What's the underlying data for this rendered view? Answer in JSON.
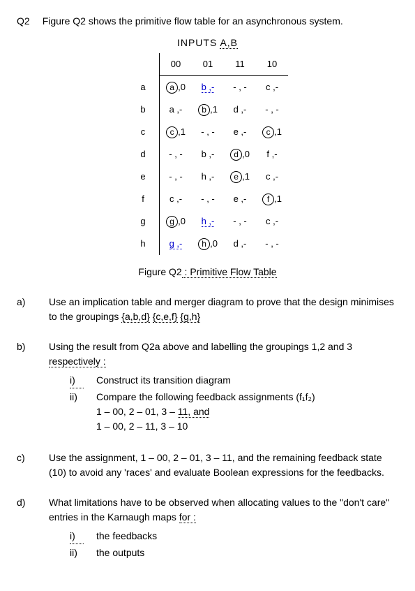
{
  "question_number": "Q2",
  "intro": "Figure Q2 shows the primitive flow table for an asynchronous system.",
  "inputs_label": "INPUTS ",
  "inputs_vars": "A,B",
  "col_headers": [
    "00",
    "01",
    "11",
    "10"
  ],
  "row_labels": [
    "a",
    "b",
    "c",
    "d",
    "e",
    "f",
    "g",
    "h"
  ],
  "cells": {
    "a": [
      {
        "c": "a",
        "o": ",0",
        "s": true
      },
      {
        "t": "b ,- ",
        "l": true
      },
      {
        "t": "- , -"
      },
      {
        "t": "c ,-"
      }
    ],
    "b": [
      {
        "t": "a ,-"
      },
      {
        "c": "b",
        "o": ",1",
        "s": true
      },
      {
        "t": "d ,-"
      },
      {
        "t": "- , -"
      }
    ],
    "c": [
      {
        "c": "c",
        "o": ",1",
        "s": true
      },
      {
        "t": "- , -"
      },
      {
        "t": "e ,-"
      },
      {
        "c": "c",
        "o": ",1",
        "s": true
      }
    ],
    "d": [
      {
        "t": "- , -"
      },
      {
        "t": "b ,-"
      },
      {
        "c": "d",
        "o": ",0",
        "s": true
      },
      {
        "t": "f ,-"
      }
    ],
    "e": [
      {
        "t": "- , -"
      },
      {
        "t": "h ,-"
      },
      {
        "c": "e",
        "o": ",1",
        "s": true
      },
      {
        "t": "c ,-"
      }
    ],
    "f": [
      {
        "t": "c ,-"
      },
      {
        "t": "- , -"
      },
      {
        "t": "e ,-"
      },
      {
        "c": "f",
        "o": ",1",
        "s": true
      }
    ],
    "g": [
      {
        "c": "g",
        "o": ",0",
        "s": true
      },
      {
        "t": "h ,-",
        "l": true
      },
      {
        "t": "- , -"
      },
      {
        "t": "c ,-"
      }
    ],
    "h": [
      {
        "t": "g ,-",
        "l": true
      },
      {
        "c": "h",
        "o": ",0",
        "s": true
      },
      {
        "t": "d ,-"
      },
      {
        "t": "- , -"
      }
    ]
  },
  "caption_pre": "Figure Q2",
  "caption_post": " : Primitive Flow Table",
  "parts": {
    "a": {
      "label": "a)",
      "text_pre": "Use an implication table and merger diagram to prove that the design minimises to the groupings ",
      "grp1": "{a,b,d}",
      "sep1": " ",
      "grp2": "{c,e,f}",
      "sep2": " ",
      "grp3": "{g,h}"
    },
    "b": {
      "label": "b)",
      "text_pre": "Using the result from Q2a above and labelling the groupings 1,2 and 3 ",
      "text_link": "respectively :",
      "i_label": "i)",
      "i_text": "Construct its transition diagram",
      "ii_label": "ii)",
      "ii_line1": "Compare the following feedback assignments (f₁f₂)",
      "ii_line2_pre": "1 – 00, 2 – 01, 3 – ",
      "ii_line2_link": "11,  and",
      "ii_line3": "1 – 00, 2 – 11, 3 – 10"
    },
    "c": {
      "label": "c)",
      "text": "Use the assignment, 1 – 00, 2 – 01, 3 – 11, and the remaining feedback state (10) to avoid any 'races' and evaluate Boolean expressions for the feedbacks."
    },
    "d": {
      "label": "d)",
      "text_pre": "What limitations have to be observed when allocating values to the \"don't care\" entries in the Karnaugh maps ",
      "text_link": "for :",
      "i_label": "i)",
      "i_text": "the feedbacks",
      "ii_label": "ii)",
      "ii_text": "the outputs"
    }
  }
}
